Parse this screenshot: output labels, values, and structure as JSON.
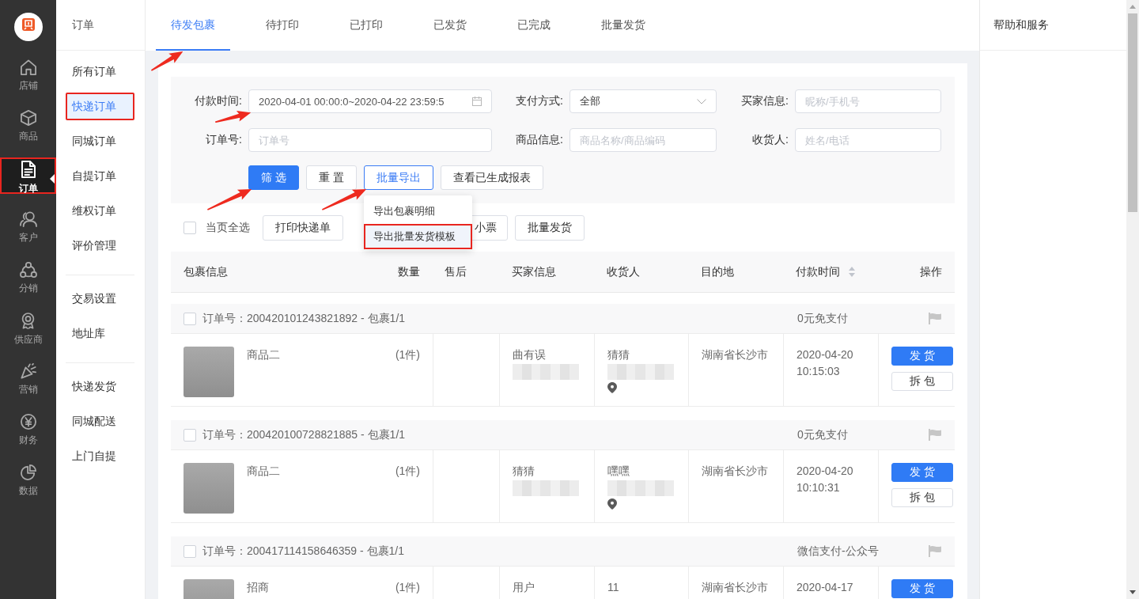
{
  "sidebar": {
    "items": [
      {
        "label": "店铺",
        "selected": false
      },
      {
        "label": "商品",
        "selected": false
      },
      {
        "label": "订单",
        "selected": true,
        "framed": true
      },
      {
        "label": "客户",
        "selected": false
      },
      {
        "label": "分销",
        "selected": false
      },
      {
        "label": "供应商",
        "selected": false
      },
      {
        "label": "营销",
        "selected": false
      },
      {
        "label": "财务",
        "selected": false
      },
      {
        "label": "数据",
        "selected": false
      }
    ]
  },
  "submenu": {
    "title": "订单",
    "groups": [
      {
        "items": [
          {
            "label": "所有订单",
            "selected": false
          },
          {
            "label": "快递订单",
            "selected": true,
            "framed": true
          },
          {
            "label": "同城订单",
            "selected": false
          },
          {
            "label": "自提订单",
            "selected": false
          },
          {
            "label": "维权订单",
            "selected": false
          },
          {
            "label": "评价管理",
            "selected": false
          }
        ]
      },
      {
        "items": [
          {
            "label": "交易设置",
            "selected": false
          },
          {
            "label": "地址库",
            "selected": false
          }
        ]
      },
      {
        "items": [
          {
            "label": "快递发货",
            "selected": false
          },
          {
            "label": "同城配送",
            "selected": false
          },
          {
            "label": "上门自提",
            "selected": false
          }
        ]
      }
    ]
  },
  "tabs": [
    {
      "label": "待发包裹",
      "selected": true,
      "marked_by_arrow": true
    },
    {
      "label": "待打印",
      "selected": false
    },
    {
      "label": "已打印",
      "selected": false
    },
    {
      "label": "已发货",
      "selected": false
    },
    {
      "label": "已完成",
      "selected": false
    },
    {
      "label": "批量发货",
      "selected": false
    }
  ],
  "filters": [
    {
      "kind": "date_range",
      "label": "付款时间:",
      "start": "2020-04-01 00:00:0",
      "separator": "~",
      "end": "2020-04-22 23:59:5",
      "marked_by_arrow": true
    },
    {
      "kind": "select",
      "label": "支付方式:",
      "value": "全部"
    },
    {
      "kind": "text",
      "label": "买家信息:",
      "placeholder": "昵称/手机号"
    },
    {
      "kind": "text",
      "label": "订单号:",
      "placeholder": "订单号"
    },
    {
      "kind": "text",
      "label": "商品信息:",
      "placeholder": "商品名称/商品编码"
    },
    {
      "kind": "text",
      "label": "收货人:",
      "placeholder": "姓名/电话"
    }
  ],
  "filter_buttons": [
    {
      "label": "筛 选",
      "kind": "primary",
      "marked_by_arrow": true
    },
    {
      "label": "重 置",
      "kind": "default"
    },
    {
      "label": "批量导出",
      "kind": "open",
      "marked_by_arrow": true,
      "menu": [
        {
          "label": "导出包裹明细",
          "selected": false
        },
        {
          "label": "导出批量发货模板",
          "selected": true,
          "framed": true
        }
      ]
    },
    {
      "label": "查看已生成报表",
      "kind": "default"
    }
  ],
  "bulk_bar": {
    "select_all": {
      "label": "当页全选",
      "checked": false
    },
    "actions": [
      {
        "label": "打印快递单",
        "covered": false
      },
      {
        "label": "小票",
        "covered": true
      },
      {
        "label": "批量发货",
        "covered": false
      }
    ]
  },
  "table": {
    "columns": [
      {
        "label": "包裹信息",
        "sortable": false
      },
      {
        "label": "数量",
        "sortable": false
      },
      {
        "label": "售后",
        "sortable": false
      },
      {
        "label": "买家信息",
        "sortable": false
      },
      {
        "label": "收货人",
        "sortable": false
      },
      {
        "label": "目的地",
        "sortable": false
      },
      {
        "label": "付款时间",
        "sortable": true
      },
      {
        "label": "操作",
        "sortable": false
      }
    ],
    "orders": [
      {
        "order_line": "订单号：200420101243821892 - 包裹1/1",
        "checked": false,
        "payment": "0元免支付",
        "product": "商品二",
        "quantity": "(1件)",
        "buyer": "曲有误",
        "recipient": "猜猜",
        "destination": "湖南省长沙市",
        "paid_date": "2020-04-20",
        "paid_time": "10:15:03",
        "actions": [
          {
            "label": "发 货",
            "kind": "primary"
          },
          {
            "label": "拆 包",
            "kind": "default"
          }
        ]
      },
      {
        "order_line": "订单号：200420100728821885 - 包裹1/1",
        "checked": false,
        "payment": "0元免支付",
        "product": "商品二",
        "quantity": "(1件)",
        "buyer": "猜猜",
        "recipient": "嘿嘿",
        "destination": "湖南省长沙市",
        "paid_date": "2020-04-20",
        "paid_time": "10:10:31",
        "actions": [
          {
            "label": "发 货",
            "kind": "primary"
          },
          {
            "label": "拆 包",
            "kind": "default"
          }
        ]
      },
      {
        "order_line": "订单号：200417114158646359 - 包裹1/1",
        "checked": false,
        "payment": "微信支付-公众号",
        "product": "招商",
        "quantity": "(1件)",
        "buyer": "用户",
        "recipient": "11",
        "destination": "湖南省长沙市",
        "paid_date": "2020-04-17",
        "actions": [
          {
            "label": "发 货",
            "kind": "primary"
          }
        ]
      }
    ]
  },
  "help_panel": {
    "title": "帮助和服务"
  }
}
